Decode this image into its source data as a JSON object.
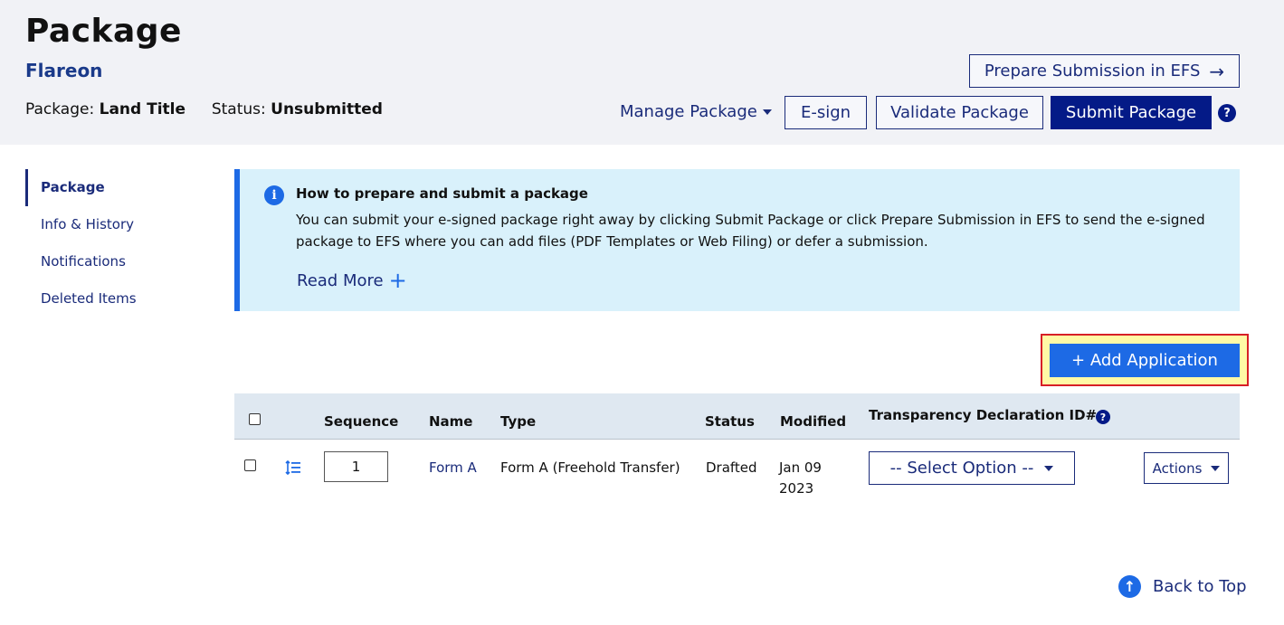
{
  "header": {
    "title": "Package",
    "org": "Flareon",
    "package_label": "Package:",
    "package_value": "Land Title",
    "status_label": "Status:",
    "status_value": "Unsubmitted",
    "prepare_label": "Prepare Submission in EFS",
    "manage_label": "Manage Package",
    "esign_label": "E-sign",
    "validate_label": "Validate Package",
    "submit_label": "Submit Package",
    "help_glyph": "?"
  },
  "sidebar": {
    "items": [
      {
        "label": "Package",
        "active": true
      },
      {
        "label": "Info & History",
        "active": false
      },
      {
        "label": "Notifications",
        "active": false
      },
      {
        "label": "Deleted Items",
        "active": false
      }
    ]
  },
  "info": {
    "icon_glyph": "i",
    "title": "How to prepare and submit a package",
    "text": "You can submit your e-signed package right away by clicking Submit Package or click Prepare Submission in EFS to send the e-signed package to EFS where you can add files (PDF Templates or Web Filing) or defer a submission.",
    "read_more": "Read More"
  },
  "add_application_label": "+ Add Application",
  "table": {
    "headers": {
      "sequence": "Sequence",
      "name": "Name",
      "type": "Type",
      "status": "Status",
      "modified": "Modified",
      "tdid": "Transparency Declaration ID#"
    },
    "rows": [
      {
        "sequence": "1",
        "name": "Form A",
        "type": "Form A (Freehold Transfer)",
        "status": "Drafted",
        "modified_line1": "Jan 09",
        "modified_line2": "2023",
        "select_label": "-- Select Option --",
        "actions_label": "Actions"
      }
    ]
  },
  "back_to_top": "Back to Top",
  "colors": {
    "primary_dark": "#041a87",
    "accent_blue": "#1d6ae5",
    "info_bg": "#d9f1fb",
    "header_bg": "#f1f2f6",
    "highlight_border": "#d71f26",
    "highlight_fill": "#fff9a6"
  },
  "icons": {
    "prepare_arrow": "arrow-right-icon",
    "manage_caret": "caret-down-icon",
    "help": "question-circle-icon",
    "info": "info-circle-icon",
    "read_more": "plus-icon",
    "reorder": "reorder-list-icon",
    "back_to_top": "arrow-up-circle-icon"
  }
}
